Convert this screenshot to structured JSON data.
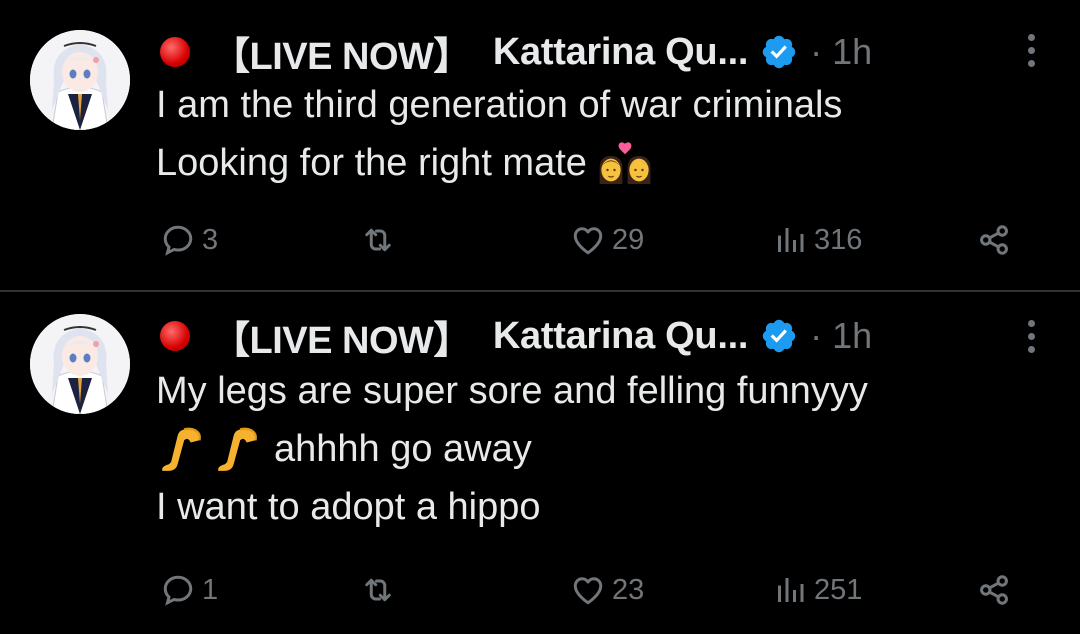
{
  "colors": {
    "background": "#000000",
    "text": "#e7e9ea",
    "muted": "#71767b",
    "verified": "#1d9bf0",
    "live_dot": "#e00000",
    "divider": "#2f3336"
  },
  "tweets": [
    {
      "live_label": "【LIVE NOW】",
      "author": "Kattarina Qu...",
      "verified": true,
      "time": "· 1h",
      "lines": [
        "I am the third generation of war criminals",
        "Looking for the right mate"
      ],
      "emoji": [
        "kiss-couple-emoji"
      ],
      "actions": {
        "replies": "3",
        "reposts": "",
        "likes": "29",
        "views": "316"
      }
    },
    {
      "live_label": "【LIVE NOW】",
      "author": "Kattarina Qu...",
      "verified": true,
      "time": "· 1h",
      "lines": [
        "My legs are super sore and felling funnyyy",
        "ahhhh go away",
        "I want to adopt a hippo"
      ],
      "emoji": [
        "leg-emoji",
        "leg-emoji"
      ],
      "actions": {
        "replies": "1",
        "reposts": "",
        "likes": "23",
        "views": "251"
      }
    }
  ]
}
